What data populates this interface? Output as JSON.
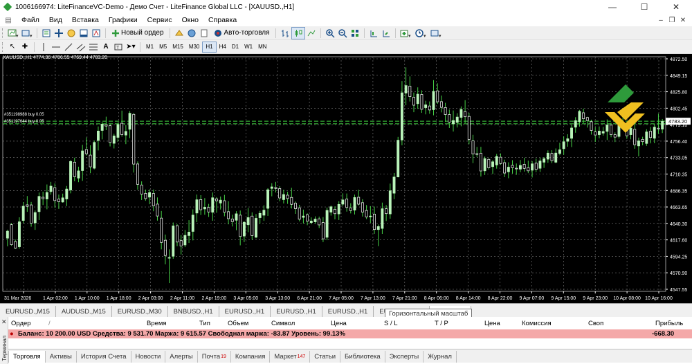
{
  "window": {
    "title": "1006166974: LiteFinanceVC-Demo - Демо Счет - LiteFinance Global LLC - [XAUUSD.,H1]"
  },
  "menu": [
    "Файл",
    "Вид",
    "Вставка",
    "Графики",
    "Сервис",
    "Окно",
    "Справка"
  ],
  "toolbar": {
    "new_order": "Новый ордер",
    "auto_trading": "Авто-торговля"
  },
  "timeframes": [
    "M1",
    "M5",
    "M15",
    "M30",
    "H1",
    "H4",
    "D1",
    "W1",
    "MN"
  ],
  "active_timeframe": "H1",
  "chart": {
    "symbol_header": "XAUUSD.,H1  4774.36 4786.55 4769.44 4783.20",
    "order_labels": [
      "#351198988 buy 0.05",
      "#351197644 buy 0.05"
    ],
    "current_price_label": "4783.20",
    "price_ticks": [
      "4872.50",
      "4849.15",
      "4825.80",
      "4802.45",
      "4779.10",
      "4756.40",
      "4733.05",
      "4710.35",
      "4686.35",
      "4663.65",
      "4640.30",
      "4617.60",
      "4594.25",
      "4570.90",
      "4547.55"
    ],
    "time_ticks": [
      "31 Mar 2026",
      "1 Apr 02:00",
      "1 Apr 10:00",
      "1 Apr 18:00",
      "2 Apr 03:00",
      "2 Apr 11:00",
      "2 Apr 19:00",
      "3 Apr 05:00",
      "3 Apr 13:00",
      "6 Apr 21:00",
      "7 Apr 05:00",
      "7 Apr 13:00",
      "7 Apr 21:00",
      "8 Apr 06:00",
      "8 Apr 14:00",
      "8 Apr 22:00",
      "9 Apr 07:00",
      "9 Apr 15:00",
      "9 Apr 23:00",
      "10 Apr 08:00",
      "10 Apr 16:00"
    ],
    "colors": {
      "background": "#000000",
      "grid": "#7f7f7f",
      "bull": "#b9f3b9",
      "bear": "#ffffff",
      "wick": "#47d247",
      "order_line": "#2f9b2f"
    }
  },
  "chart_tabs": [
    "EURUSD.,M15",
    "AUDUSD.,M15",
    "EURUSD.,M30",
    "BNBUSD.,H1",
    "EURUSD.,H1",
    "EURUSD.,H1",
    "EURUSD.,H1",
    "EURUSD.,M15"
  ],
  "tooltip": "Горизонтальный масштаб",
  "terminal": {
    "side_label": "Терминал",
    "columns": {
      "order": "Ордер",
      "time": "Время",
      "type": "Тип",
      "volume": "Объем",
      "symbol": "Символ",
      "price": "Цена",
      "sl": "S / L",
      "tp": "T / P",
      "price2": "Цена",
      "commission": "Комиссия",
      "swap": "Своп",
      "profit": "Прибыль"
    },
    "balance_line": "Баланс: 10 200.00 USD  Средства: 9 531.70  Маржа: 9 615.57  Свободная маржа: -83.87  Уровень: 99.13%",
    "profit_total": "-668.30",
    "tabs": [
      {
        "label": "Торговля",
        "badge": ""
      },
      {
        "label": "Активы",
        "badge": ""
      },
      {
        "label": "История Счета",
        "badge": ""
      },
      {
        "label": "Новости",
        "badge": ""
      },
      {
        "label": "Алерты",
        "badge": ""
      },
      {
        "label": "Почта",
        "badge": "19"
      },
      {
        "label": "Компания",
        "badge": ""
      },
      {
        "label": "Маркет",
        "badge": "147"
      },
      {
        "label": "Статьи",
        "badge": ""
      },
      {
        "label": "Библиотека",
        "badge": ""
      },
      {
        "label": "Эксперты",
        "badge": ""
      },
      {
        "label": "Журнал",
        "badge": ""
      }
    ]
  },
  "chart_data": {
    "type": "candlestick",
    "price_range": [
      4547.55,
      4872.5
    ],
    "candles": [
      [
        4621.2,
        4633.0,
        4609.9,
        4630.9
      ],
      [
        4639.9,
        4642.1,
        4610.7,
        4612.2
      ],
      [
        4616.6,
        4619.2,
        4606.0,
        4607.3
      ],
      [
        4609.3,
        4650.1,
        4606.7,
        4643.9
      ],
      [
        4645.7,
        4671.3,
        4642.2,
        4665.5
      ],
      [
        4667.4,
        4679.6,
        4657.7,
        4665.3
      ],
      [
        4667.3,
        4671.4,
        4637.1,
        4641.8
      ],
      [
        4642.4,
        4659.6,
        4632.7,
        4656.7
      ],
      [
        4657.9,
        4684.4,
        4646.3,
        4679.1
      ],
      [
        4677.9,
        4685.6,
        4667.2,
        4675.9
      ],
      [
        4675.5,
        4695.6,
        4661.2,
        4684.5
      ],
      [
        4685.7,
        4699.2,
        4681.4,
        4693.3
      ],
      [
        4691.2,
        4697.1,
        4663.3,
        4673.2
      ],
      [
        4675.3,
        4681.6,
        4661.7,
        4671.7
      ],
      [
        4671.3,
        4682.9,
        4670.3,
        4677.1
      ],
      [
        4675.5,
        4693.5,
        4665.6,
        4689.3
      ],
      [
        4687.9,
        4729.2,
        4683.3,
        4727.5
      ],
      [
        4726.5,
        4732.7,
        4700.0,
        4706.4
      ],
      [
        4704.4,
        4720.2,
        4698.8,
        4714.4
      ],
      [
        4714.8,
        4750.5,
        4700.5,
        4742.1
      ],
      [
        4744.0,
        4760.7,
        4735.6,
        4738.1
      ],
      [
        4736.3,
        4749.8,
        4711.3,
        4720.0
      ],
      [
        4718.1,
        4756.4,
        4716.5,
        4753.9
      ],
      [
        4756.5,
        4776.0,
        4742.7,
        4769.6
      ],
      [
        4770.4,
        4782.0,
        4758.1,
        4779.1
      ],
      [
        4778.3,
        4789.5,
        4770.9,
        4776.5
      ],
      [
        4777.0,
        4779.0,
        4748.3,
        4753.7
      ],
      [
        4752.6,
        4765.8,
        4745.5,
        4762.8
      ],
      [
        4760.8,
        4781.3,
        4754.8,
        4778.7
      ],
      [
        4780.4,
        4797.9,
        4761.9,
        4764.6
      ],
      [
        4764.0,
        4777.7,
        4751.5,
        4769.1
      ],
      [
        4772.0,
        4797.2,
        4759.8,
        4794.2
      ],
      [
        4792.7,
        4794.6,
        4712.1,
        4723.8
      ],
      [
        4724.0,
        4727.5,
        4688.3,
        4695.8
      ],
      [
        4694.9,
        4699.9,
        4674.1,
        4682.1
      ],
      [
        4683.3,
        4688.6,
        4673.0,
        4676.0
      ],
      [
        4678.0,
        4688.8,
        4668.2,
        4684.3
      ],
      [
        4683.2,
        4688.6,
        4658.5,
        4666.0
      ],
      [
        4668.4,
        4677.6,
        4645.5,
        4651.9
      ],
      [
        4649.0,
        4658.9,
        4605.7,
        4615.3
      ],
      [
        4618.3,
        4626.2,
        4584.9,
        4597.2
      ],
      [
        4593.9,
        4605.7,
        4559.0,
        4594.4
      ],
      [
        4596.2,
        4642.9,
        4592.7,
        4638.2
      ],
      [
        4638.5,
        4640.6,
        4610.1,
        4615.8
      ],
      [
        4617.8,
        4625.5,
        4598.6,
        4610.2
      ],
      [
        4611.8,
        4632.5,
        4608.8,
        4625.1
      ],
      [
        4624.8,
        4646.2,
        4614.6,
        4629.6
      ],
      [
        4630.5,
        4661.1,
        4618.1,
        4653.2
      ],
      [
        4656.0,
        4681.6,
        4643.4,
        4674.4
      ],
      [
        4674.7,
        4680.8,
        4653.3,
        4660.6
      ],
      [
        4661.7,
        4676.7,
        4653.6,
        4664.1
      ],
      [
        4663.8,
        4668.7,
        4650.5,
        4657.5
      ],
      [
        4657.1,
        4684.5,
        4645.3,
        4677.2
      ],
      [
        4675.7,
        4678.0,
        4656.4,
        4672.9
      ],
      [
        4669.8,
        4678.9,
        4660.9,
        4673.9
      ],
      [
        4673.1,
        4681.2,
        4651.5,
        4657.1
      ],
      [
        4657.9,
        4672.4,
        4640.4,
        4648.2
      ],
      [
        4647.7,
        4653.7,
        4637.4,
        4644.1
      ],
      [
        4646.0,
        4658.6,
        4632.2,
        4655.0
      ],
      [
        4653.1,
        4659.5,
        4611.3,
        4623.5
      ],
      [
        4624.1,
        4644.6,
        4615.7,
        4643.3
      ],
      [
        4639.8,
        4662.9,
        4629.5,
        4649.7
      ],
      [
        4651.8,
        4656.9,
        4619.0,
        4624.8
      ],
      [
        4622.5,
        4654.6,
        4621.1,
        4648.7
      ],
      [
        4649.6,
        4659.1,
        4641.3,
        4655.6
      ],
      [
        4653.0,
        4666.8,
        4645.2,
        4660.0
      ],
      [
        4662.5,
        4690.4,
        4652.1,
        4688.3
      ],
      [
        4690.1,
        4697.3,
        4679.2,
        4692.3
      ],
      [
        4691.4,
        4699.2,
        4684.5,
        4690.1
      ],
      [
        4689.9,
        4693.1,
        4672.3,
        4676.9
      ],
      [
        4674.6,
        4688.3,
        4669.2,
        4681.7
      ],
      [
        4680.8,
        4685.5,
        4668.7,
        4676.1
      ],
      [
        4677.7,
        4690.9,
        4662.3,
        4668.1
      ],
      [
        4669.7,
        4672.0,
        4654.9,
        4662.1
      ],
      [
        4663.2,
        4667.4,
        4644.5,
        4647.4
      ],
      [
        4650.0,
        4660.8,
        4641.4,
        4651.9
      ],
      [
        4653.7,
        4655.6,
        4639.2,
        4644.7
      ],
      [
        4642.8,
        4650.0,
        4640.5,
        4645.0
      ],
      [
        4643.8,
        4651.4,
        4641.1,
        4647.6
      ],
      [
        4648.0,
        4651.0,
        4635.2,
        4639.6
      ],
      [
        4642.9,
        4650.4,
        4615.8,
        4620.3
      ],
      [
        4622.4,
        4663.7,
        4618.4,
        4659.7
      ],
      [
        4657.2,
        4666.3,
        4652.5,
        4664.7
      ],
      [
        4661.3,
        4665.2,
        4647.2,
        4655.1
      ],
      [
        4654.8,
        4672.3,
        4646.4,
        4668.0
      ],
      [
        4668.3,
        4683.3,
        4665.7,
        4674.2
      ],
      [
        4675.3,
        4683.1,
        4658.0,
        4663.7
      ],
      [
        4662.9,
        4669.6,
        4655.5,
        4659.5
      ],
      [
        4660.0,
        4681.5,
        4654.0,
        4677.5
      ],
      [
        4677.9,
        4688.3,
        4666.5,
        4668.3
      ],
      [
        4670.4,
        4675.2,
        4651.1,
        4657.3
      ],
      [
        4659.6,
        4667.1,
        4647.6,
        4650.4
      ],
      [
        4650.6,
        4665.6,
        4642.3,
        4651.9
      ],
      [
        4654.6,
        4665.0,
        4627.2,
        4633.2
      ],
      [
        4633.1,
        4640.1,
        4610.2,
        4637.3
      ],
      [
        4634.7,
        4670.5,
        4627.1,
        4662.0
      ],
      [
        4662.0,
        4667.0,
        4645.0,
        4655.2
      ],
      [
        4654.8,
        4696.8,
        4648.2,
        4686.8
      ],
      [
        4683.5,
        4711.5,
        4675.2,
        4705.9
      ],
      [
        4706.0,
        4761.5,
        4705.4,
        4756.9
      ],
      [
        4757.2,
        4838.8,
        4749.8,
        4822.6
      ],
      [
        4822.1,
        4857.8,
        4805.4,
        4832.6
      ],
      [
        4831.9,
        4845.3,
        4810.5,
        4817.3
      ],
      [
        4816.5,
        4822.9,
        4795.7,
        4805.4
      ],
      [
        4807.5,
        4830.1,
        4800.3,
        4820.7
      ],
      [
        4820.3,
        4826.0,
        4794.8,
        4799.7
      ],
      [
        4802.0,
        4811.5,
        4792.7,
        4805.9
      ],
      [
        4804.3,
        4810.6,
        4793.5,
        4798.8
      ],
      [
        4799.2,
        4840.1,
        4791.4,
        4824.5
      ],
      [
        4825.3,
        4835.7,
        4807.3,
        4810.1
      ],
      [
        4810.3,
        4818.7,
        4795.4,
        4802.4
      ],
      [
        4802.2,
        4808.7,
        4782.3,
        4792.5
      ],
      [
        4792.5,
        4799.4,
        4773.8,
        4781.8
      ],
      [
        4779.6,
        4798.1,
        4768.9,
        4784.2
      ],
      [
        4781.5,
        4794.3,
        4774.5,
        4789.0
      ],
      [
        4788.4,
        4803.7,
        4776.2,
        4799.5
      ],
      [
        4796.6,
        4812.3,
        4780.6,
        4789.4
      ],
      [
        4789.9,
        4794.9,
        4751.4,
        4757.9
      ],
      [
        4755.9,
        4764.4,
        4725.1,
        4737.7
      ],
      [
        4738.2,
        4747.6,
        4733.9,
        4738.1
      ],
      [
        4738.9,
        4747.7,
        4706.6,
        4714.3
      ],
      [
        4714.5,
        4734.4,
        4708.7,
        4731.5
      ],
      [
        4730.4,
        4732.0,
        4716.3,
        4718.6
      ],
      [
        4720.3,
        4729.3,
        4710.0,
        4727.0
      ],
      [
        4722.6,
        4737.9,
        4717.5,
        4734.4
      ],
      [
        4733.4,
        4738.6,
        4723.0,
        4724.6
      ],
      [
        4725.8,
        4730.0,
        4705.7,
        4711.4
      ],
      [
        4713.1,
        4726.3,
        4704.2,
        4719.6
      ],
      [
        4722.1,
        4729.2,
        4710.6,
        4718.7
      ],
      [
        4718.1,
        4724.6,
        4708.9,
        4717.3
      ],
      [
        4716.8,
        4729.5,
        4712.6,
        4722.0
      ],
      [
        4723.5,
        4732.7,
        4713.4,
        4717.9
      ],
      [
        4718.9,
        4728.6,
        4711.3,
        4714.5
      ],
      [
        4715.3,
        4728.0,
        4705.3,
        4724.2
      ],
      [
        4725.1,
        4731.5,
        4712.7,
        4716.5
      ],
      [
        4718.0,
        4732.6,
        4712.9,
        4728.1
      ],
      [
        4726.4,
        4733.5,
        4718.5,
        4731.3
      ],
      [
        4730.6,
        4742.8,
        4725.6,
        4739.0
      ],
      [
        4738.6,
        4743.0,
        4725.1,
        4728.5
      ],
      [
        4726.4,
        4745.5,
        4725.0,
        4739.1
      ],
      [
        4738.5,
        4753.3,
        4736.1,
        4743.6
      ],
      [
        4745.1,
        4762.2,
        4736.7,
        4754.8
      ],
      [
        4755.4,
        4765.2,
        4747.9,
        4758.9
      ],
      [
        4759.5,
        4778.1,
        4747.4,
        4773.8
      ],
      [
        4774.9,
        4788.8,
        4767.3,
        4784.0
      ],
      [
        4782.4,
        4798.9,
        4775.7,
        4796.9
      ],
      [
        4794.9,
        4800.7,
        4780.6,
        4786.6
      ],
      [
        4788.4,
        4789.4,
        4774.4,
        4784.2
      ],
      [
        4782.6,
        4785.3,
        4764.7,
        4770.4
      ],
      [
        4768.4,
        4774.8,
        4754.6,
        4764.1
      ],
      [
        4764.6,
        4776.0,
        4759.5,
        4769.5
      ],
      [
        4766.7,
        4775.3,
        4763.2,
        4769.0
      ],
      [
        4769.1,
        4785.7,
        4757.1,
        4778.0
      ],
      [
        4777.8,
        4781.0,
        4761.0,
        4764.6
      ],
      [
        4764.6,
        4767.7,
        4754.4,
        4761.2
      ],
      [
        4762.1,
        4781.0,
        4759.3,
        4777.2
      ],
      [
        4775.6,
        4789.8,
        4771.7,
        4775.6
      ],
      [
        4775.2,
        4778.1,
        4758.8,
        4763.0
      ],
      [
        4764.6,
        4774.8,
        4758.1,
        4773.7
      ],
      [
        4772.0,
        4778.9,
        4745.1,
        4750.6
      ],
      [
        4749.0,
        4760.5,
        4734.6,
        4755.9
      ],
      [
        4758.1,
        4761.7,
        4749.8,
        4754.9
      ],
      [
        4752.4,
        4772.1,
        4749.0,
        4768.4
      ],
      [
        4769.3,
        4775.2,
        4752.5,
        4760.6
      ],
      [
        4759.6,
        4779.4,
        4752.7,
        4775.0
      ],
      [
        4773.6,
        4793.7,
        4765.8,
        4772.6
      ],
      [
        4772.2,
        4786.3,
        4766.8,
        4783.2
      ]
    ],
    "orders": [
      {
        "label": "#351198988 buy 0.05",
        "price": 4783.2
      },
      {
        "label": "#351197644 buy 0.05",
        "price": 4779.7
      }
    ],
    "current_price": 4783.2
  }
}
